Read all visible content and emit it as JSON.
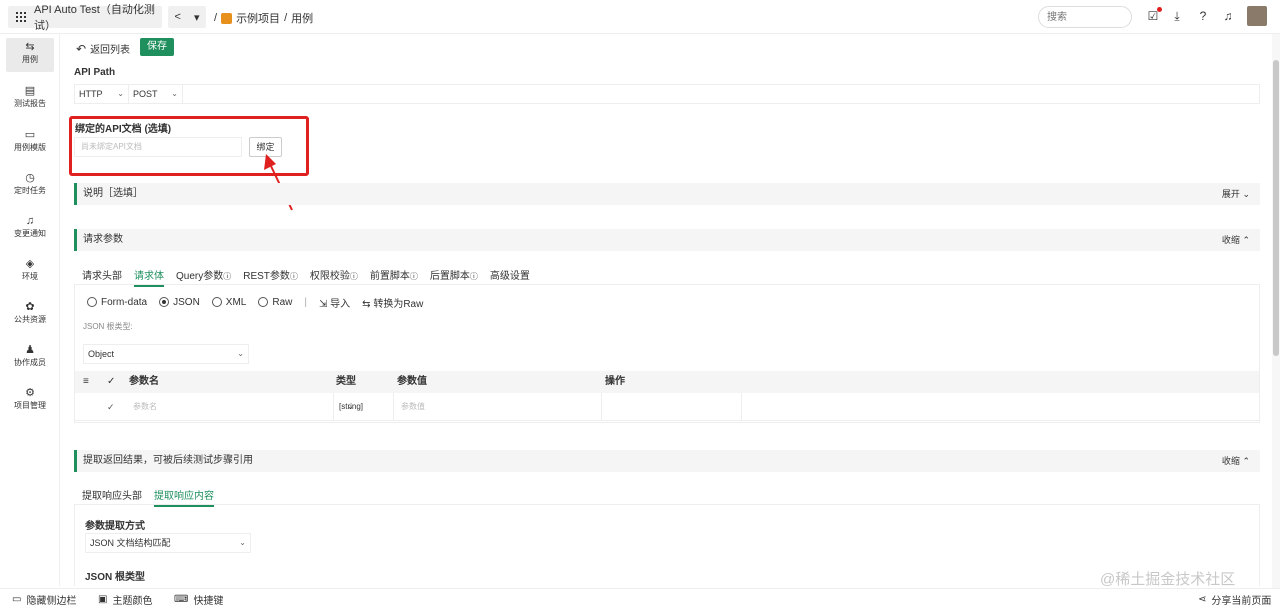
{
  "topbar": {
    "app_title": "API Auto Test（自动化测试）",
    "back_glyph": "<",
    "dropdown_glyph": "▾",
    "breadcrumb_sep": "/",
    "breadcrumb_project": "示例项目",
    "breadcrumb_page": "用例",
    "search_placeholder": "搜索"
  },
  "sidebar": {
    "items": [
      {
        "label": "用例",
        "icon": "swap-icon",
        "glyph": "⇆"
      },
      {
        "label": "测试报告",
        "icon": "report-icon",
        "glyph": "▤"
      },
      {
        "label": "用例模版",
        "icon": "template-icon",
        "glyph": "▭"
      },
      {
        "label": "定时任务",
        "icon": "clock-icon",
        "glyph": "◷"
      },
      {
        "label": "变更通知",
        "icon": "bell-icon",
        "glyph": "♫"
      },
      {
        "label": "环境",
        "icon": "cube-icon",
        "glyph": "◈"
      },
      {
        "label": "公共资源",
        "icon": "puzzle-icon",
        "glyph": "✿"
      },
      {
        "label": "协作成员",
        "icon": "user-icon",
        "glyph": "♟"
      },
      {
        "label": "项目管理",
        "icon": "settings-icon",
        "glyph": "⚙"
      }
    ]
  },
  "toolbar": {
    "back_label": "返回列表",
    "save_label": "保存"
  },
  "api_path": {
    "label": "API Path",
    "protocol": "HTTP",
    "method": "POST",
    "path_value": ""
  },
  "api_doc": {
    "label": "绑定的API文档 (选填)",
    "placeholder": "尚未绑定API文档",
    "bind_label": "绑定"
  },
  "description": {
    "label": "说明［选填］",
    "toggle": "展开"
  },
  "request_params": {
    "label": "请求参数",
    "toggle": "收缩",
    "tabs": [
      "请求头部",
      "请求体",
      "Query参数",
      "REST参数",
      "权限校验",
      "前置脚本",
      "后置脚本",
      "高级设置"
    ],
    "active_tab": "请求体",
    "info_glyph": "ⓘ",
    "body_types": [
      "Form-data",
      "JSON",
      "XML",
      "Raw"
    ],
    "selected_body_type": "JSON",
    "import_label": "导入",
    "convert_label": "转换为Raw",
    "json_root_label": "JSON 根类型:",
    "json_root_value": "Object",
    "table": {
      "headers": [
        "参数名",
        "类型",
        "参数值",
        "操作"
      ],
      "row": {
        "name_placeholder": "参数名",
        "type": "[string]",
        "value_placeholder": "参数值"
      }
    }
  },
  "extract": {
    "label": "提取返回结果，可被后续测试步骤引用",
    "toggle": "收缩",
    "tabs": [
      "提取响应头部",
      "提取响应内容"
    ],
    "active_tab": "提取响应内容",
    "method_label": "参数提取方式",
    "method_value": "JSON 文档结构匹配",
    "json_root_label": "JSON 根类型"
  },
  "bottombar": {
    "hide_sidebar": "隐藏侧边栏",
    "theme_color": "主题颜色",
    "shortcuts": "快捷键",
    "share": "分享当前页面"
  },
  "watermark": "@稀土掘金技术社区",
  "colors": {
    "accent": "#1e8f5d",
    "highlight": "#e0201e"
  }
}
